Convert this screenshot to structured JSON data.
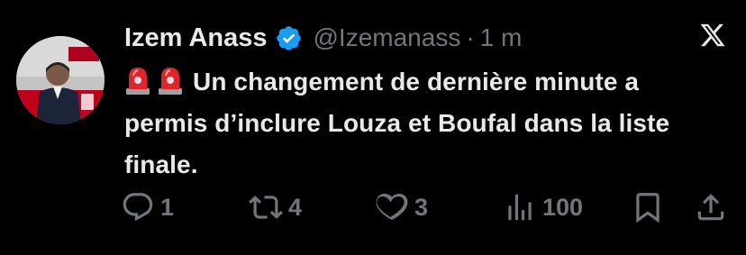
{
  "tweet": {
    "display_name": "Izem Anass",
    "handle": "@Izemanass",
    "separator": "·",
    "time": "1 m",
    "text_line1": "Un changement de dernière minute a",
    "text_line2": "permis d’inclure Louza et Boufal dans la liste",
    "text_line3": "finale.",
    "emoji": [
      "police-car-light",
      "police-car-light"
    ]
  },
  "actions": {
    "replies": "1",
    "reposts": "4",
    "likes": "3",
    "views": "100"
  },
  "colors": {
    "background": "#000000",
    "text": "#e7e9ea",
    "muted": "#71767b",
    "verified": "#1d9bf0"
  }
}
